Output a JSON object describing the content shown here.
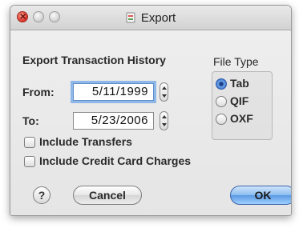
{
  "window": {
    "title": "Export"
  },
  "form": {
    "section_label": "Export Transaction History",
    "from_label": "From:",
    "from_value": "5/11/1999",
    "to_label": "To:",
    "to_value": "5/23/2006"
  },
  "checkboxes": [
    {
      "label": "Include Transfers",
      "checked": false
    },
    {
      "label": "Include Credit Card Charges",
      "checked": false
    }
  ],
  "file_type": {
    "label": "File Type",
    "options": [
      {
        "label": "Tab",
        "selected": true
      },
      {
        "label": "QIF",
        "selected": false
      },
      {
        "label": "OXF",
        "selected": false
      }
    ]
  },
  "buttons": {
    "help": "?",
    "cancel": "Cancel",
    "ok": "OK"
  },
  "colors": {
    "default_button": "#5b98e3",
    "focus_ring": "#8fb7e8",
    "close_light": "#d8322a"
  }
}
